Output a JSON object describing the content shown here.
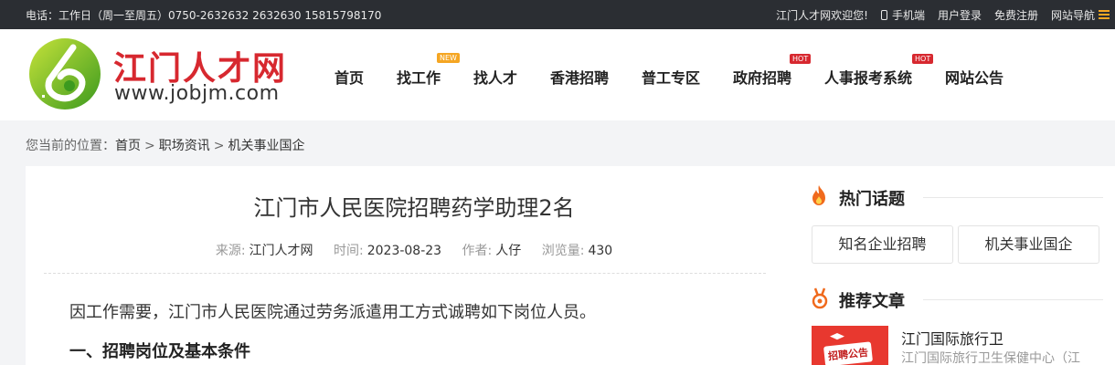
{
  "topbar": {
    "contact": "电话：工作日（周一至周五）0750-2632632 2632630 15815798170",
    "welcome": "江门人才网欢迎您!",
    "mobile": "手机端",
    "login": "用户登录",
    "register": "免费注册",
    "sitenav": "网站导航"
  },
  "logo": {
    "cn": "江门人才网",
    "en": "www.jobjm.com"
  },
  "nav": {
    "items": [
      {
        "label": "首页"
      },
      {
        "label": "找工作",
        "tag": "NEW"
      },
      {
        "label": "找人才"
      },
      {
        "label": "香港招聘"
      },
      {
        "label": "普工专区"
      },
      {
        "label": "政府招聘",
        "tag": "HOT"
      },
      {
        "label": "人事报考系统",
        "tag": "HOT"
      },
      {
        "label": "网站公告"
      }
    ]
  },
  "breadcrumb": {
    "prefix": "您当前的位置：",
    "items": [
      "首页",
      "职场资讯",
      "机关事业国企"
    ],
    "separator": ">"
  },
  "article": {
    "title": "江门市人民医院招聘药学助理2名",
    "meta": {
      "source_label": "来源:",
      "source": "江门人才网",
      "time_label": "时间:",
      "time": "2023-08-23",
      "author_label": "作者:",
      "author": "人仔",
      "views_label": "浏览量:",
      "views": "430"
    },
    "paragraph": "因工作需要，江门市人民医院通过劳务派遣用工方式诚聘如下岗位人员。",
    "section_heading": "一、招聘岗位及基本条件"
  },
  "sidebar": {
    "hot_topics": {
      "title": "热门话题",
      "items": [
        "知名企业招聘",
        "机关事业国企"
      ]
    },
    "recommended": {
      "title": "推荐文章",
      "items": [
        {
          "thumb_text": "招聘公告",
          "title": "江门国际旅行卫",
          "desc": "江门国际旅行卫生保健中心（江"
        }
      ]
    }
  },
  "colors": {
    "brand_red": "#d7282f",
    "accent_orange": "#f5a623",
    "topbar_bg": "#2b2e33"
  }
}
